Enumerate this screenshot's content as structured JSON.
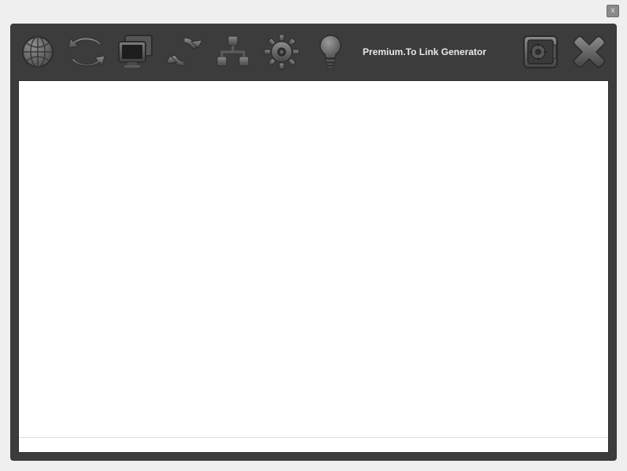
{
  "window": {
    "close_label": "x"
  },
  "app": {
    "title": "Premium.To Link Generator"
  },
  "toolbar": {
    "icons": {
      "globe": "globe-icon",
      "sync": "sync-icon",
      "screens": "screens-icon",
      "refresh": "refresh-icon",
      "network": "network-icon",
      "gear": "gear-icon",
      "bulb": "bulb-icon",
      "safe": "safe-icon",
      "close": "close-icon"
    }
  },
  "content": {
    "text_value": "",
    "status_value": ""
  }
}
